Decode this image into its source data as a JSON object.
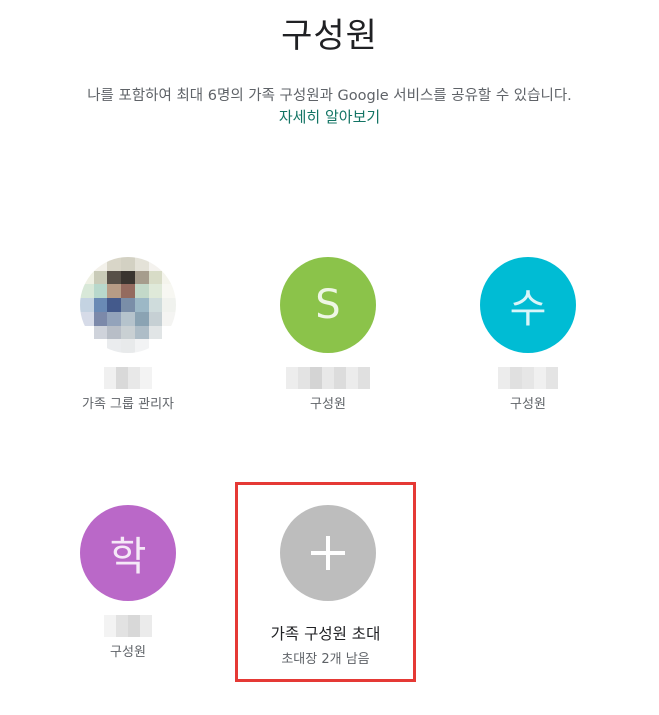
{
  "header": {
    "title": "구성원",
    "description": "나를 포함하여 최대 6명의 가족 구성원과 Google 서비스를 공유할 수 있습니다.",
    "learn_more": "자세히 알아보기"
  },
  "members": [
    {
      "role": "가족 그룹 관리자",
      "avatar_type": "photo"
    },
    {
      "role": "구성원",
      "avatar_letter": "S",
      "avatar_color": "#8bc34a"
    },
    {
      "role": "구성원",
      "avatar_letter": "수",
      "avatar_color": "#00bcd4"
    },
    {
      "role": "구성원",
      "avatar_letter": "학",
      "avatar_color": "#ba68c8"
    }
  ],
  "invite": {
    "label": "가족 구성원 초대",
    "remaining": "초대장 2개 남음",
    "avatar_color": "#bdbdbd",
    "highlight_color": "#e53935"
  },
  "colors": {
    "link": "#137464",
    "text_primary": "#202124",
    "text_secondary": "#5f6368"
  }
}
